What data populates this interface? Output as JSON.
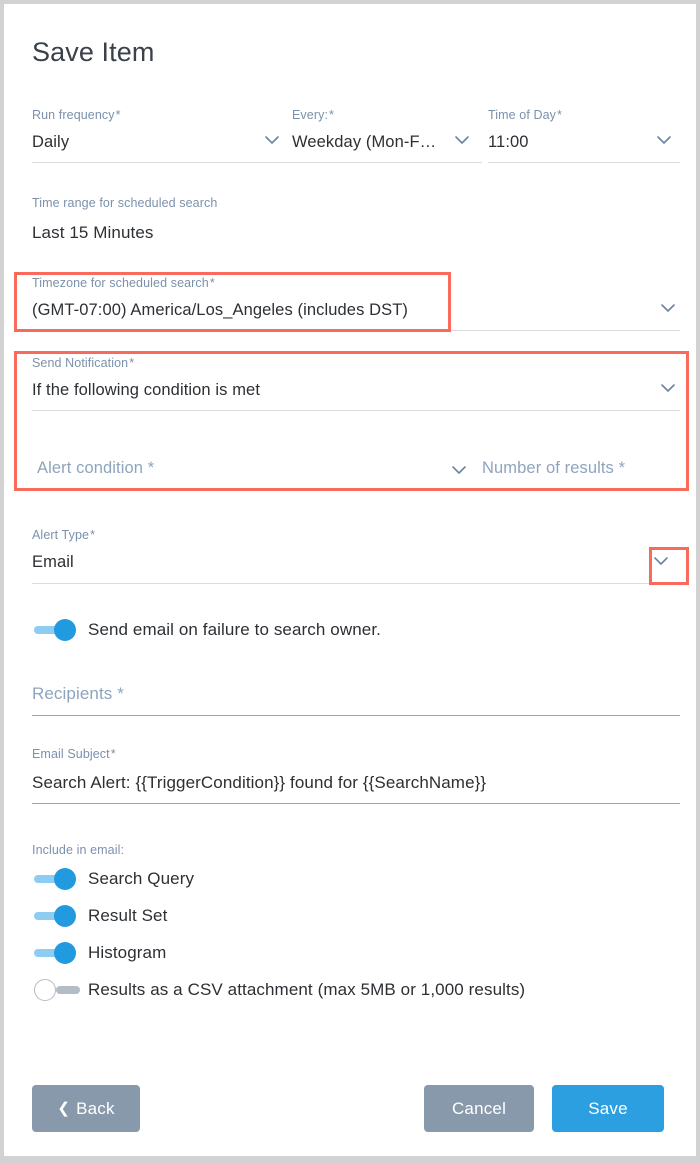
{
  "dialog": {
    "title": "Save Item"
  },
  "fields": {
    "run_frequency": {
      "label": "Run frequency",
      "required": "*",
      "value": "Daily",
      "icon": "chevron-down-icon"
    },
    "every": {
      "label": "Every:",
      "required": "*",
      "value": "Weekday (Mon-F…",
      "icon": "chevron-down-icon"
    },
    "time_of_day": {
      "label": "Time of Day",
      "required": "*",
      "value": "11:00",
      "icon": "chevron-down-icon"
    },
    "time_range": {
      "label": "Time range for scheduled search",
      "value": "Last 15 Minutes"
    },
    "timezone": {
      "label": "Timezone for scheduled search",
      "required": "*",
      "value": "(GMT-07:00) America/Los_Angeles (includes DST)",
      "icon": "chevron-down-icon"
    },
    "send_notification": {
      "label": "Send Notification",
      "required": "*",
      "value": "If the following condition is met",
      "icon": "chevron-down-icon"
    },
    "alert_condition": {
      "placeholder": "Alert condition *",
      "value": "",
      "icon": "chevron-down-icon"
    },
    "number_of_results": {
      "placeholder": "Number of results *",
      "value": ""
    },
    "alert_type": {
      "label": "Alert Type",
      "required": "*",
      "value": "Email",
      "icon": "chevron-down-icon"
    },
    "recipients": {
      "placeholder": "Recipients *",
      "value": ""
    },
    "email_subject": {
      "label": "Email Subject",
      "required": "*",
      "value": "Search Alert: {{TriggerCondition}} found for {{SearchName}}"
    }
  },
  "toggles": {
    "send_email_failure": {
      "label": "Send email on failure to search owner.",
      "state": "on"
    },
    "include_label": "Include in email:",
    "include_items": [
      {
        "label": "Search Query",
        "state": "on"
      },
      {
        "label": "Result Set",
        "state": "on"
      },
      {
        "label": "Histogram",
        "state": "on"
      },
      {
        "label": "Results as a CSV attachment (max 5MB or 1,000 results)",
        "state": "off"
      }
    ]
  },
  "footer": {
    "back": "Back",
    "back_icon": "chevron-left-icon",
    "cancel": "Cancel",
    "save": "Save"
  },
  "colors": {
    "accent_blue": "#2c9fe0",
    "toggle_track_on": "#8dcdf2",
    "toggle_off": "#b4bcc5",
    "grey_button": "#8899ab",
    "highlight_red": "#f9695c",
    "label_blue": "#7b91ac"
  },
  "annotations": [
    {
      "name": "timezone-highlight"
    },
    {
      "name": "send-notification-highlight"
    },
    {
      "name": "alert-type-chevron-highlight"
    }
  ]
}
